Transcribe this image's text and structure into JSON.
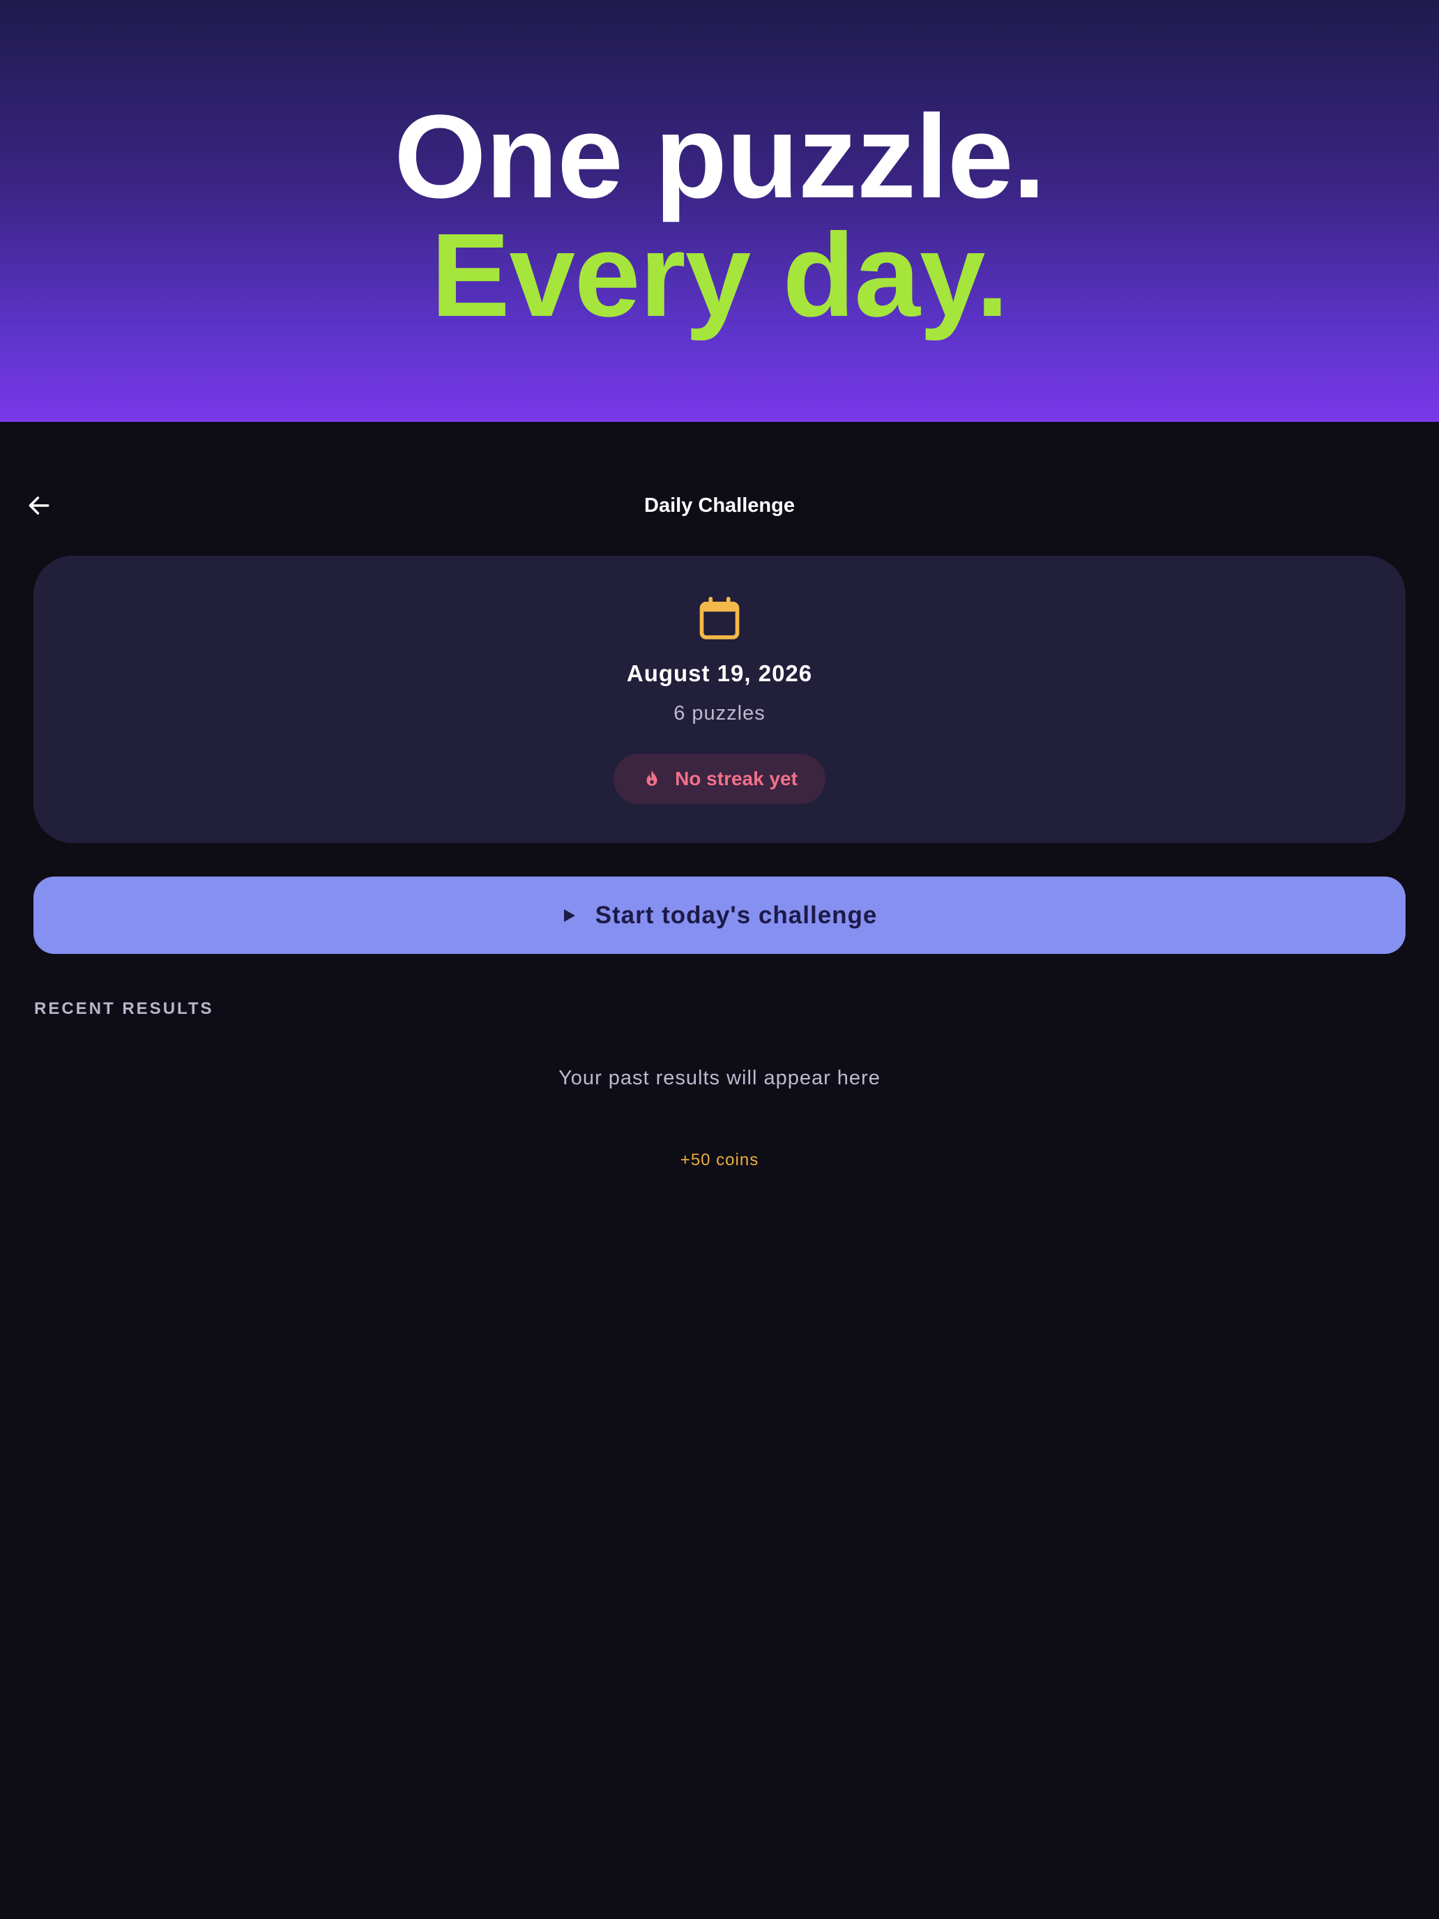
{
  "hero": {
    "line1": "One puzzle.",
    "line2": "Every day."
  },
  "topbar": {
    "back_icon": "arrow-left-icon",
    "title": "Daily Challenge"
  },
  "challenge_card": {
    "icon": "calendar-icon",
    "date": "August 19, 2026",
    "puzzle_count": "6 puzzles",
    "streak": {
      "icon": "flame-icon",
      "label": "No streak yet"
    }
  },
  "start_button": {
    "icon": "play-icon",
    "label": "Start today's challenge"
  },
  "recent_results": {
    "title": "RECENT RESULTS",
    "empty_message": "Your past results will appear here"
  },
  "reward": {
    "label": "+50 coins"
  },
  "colors": {
    "accent_green": "#a6e63c",
    "accent_indigo": "#8690f0",
    "calendar_gold": "#f5b84a",
    "streak_pink": "#f2708a",
    "coins_gold": "#e9ae3f",
    "background": "#0e0d16",
    "card": "#221f3b"
  }
}
